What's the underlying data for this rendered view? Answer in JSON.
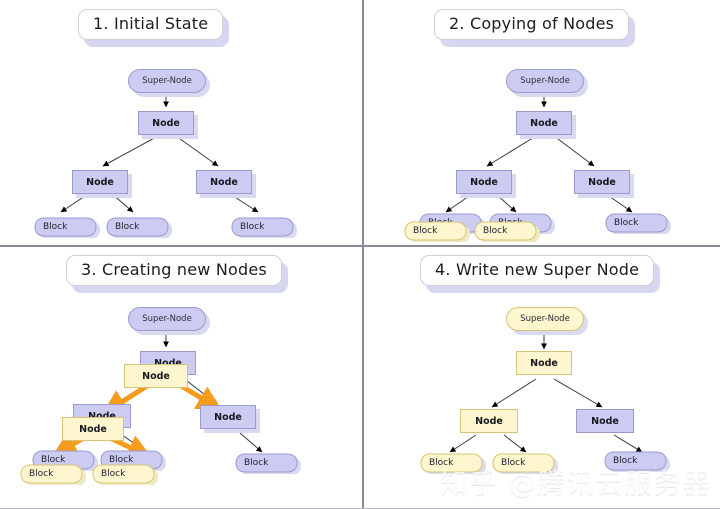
{
  "diagram": {
    "title_font_color": "#1c1c1c",
    "colors": {
      "purple_fill": "#ccccf2",
      "purple_stroke": "#9a9ad0",
      "yellow_fill": "#fdf6cf",
      "yellow_stroke": "#d8c476",
      "shadow": "#d9d9ef",
      "arrow_black": "#000000",
      "arrow_orange": "#f59c1a",
      "divider": "#8a8a96",
      "panel_bg": "#ffffff"
    }
  },
  "panels": [
    {
      "id": "panel-1",
      "title": "1. Initial State",
      "nodes": [
        {
          "name": "super-node",
          "label": "Super-Node",
          "shape": "supernode",
          "color": "purple"
        },
        {
          "name": "root-node",
          "label": "Node",
          "shape": "node",
          "color": "purple"
        },
        {
          "name": "left-node",
          "label": "Node",
          "shape": "node",
          "color": "purple"
        },
        {
          "name": "right-node",
          "label": "Node",
          "shape": "node",
          "color": "purple"
        },
        {
          "name": "block-1",
          "label": "Block",
          "shape": "block",
          "color": "purple"
        },
        {
          "name": "block-2",
          "label": "Block",
          "shape": "block",
          "color": "purple"
        },
        {
          "name": "block-3",
          "label": "Block",
          "shape": "block",
          "color": "purple"
        }
      ]
    },
    {
      "id": "panel-2",
      "title": "2. Copying of Nodes",
      "nodes": [
        {
          "name": "super-node",
          "label": "Super-Node",
          "shape": "supernode",
          "color": "purple"
        },
        {
          "name": "root-node",
          "label": "Node",
          "shape": "node",
          "color": "purple"
        },
        {
          "name": "left-node",
          "label": "Node",
          "shape": "node",
          "color": "purple"
        },
        {
          "name": "right-node",
          "label": "Node",
          "shape": "node",
          "color": "purple"
        },
        {
          "name": "block-1",
          "label": "Block",
          "shape": "block",
          "color": "purple"
        },
        {
          "name": "block-2",
          "label": "Block",
          "shape": "block",
          "color": "purple"
        },
        {
          "name": "block-3",
          "label": "Block",
          "shape": "block",
          "color": "purple"
        },
        {
          "name": "block-1-copy",
          "label": "Block",
          "shape": "block",
          "color": "yellow"
        },
        {
          "name": "block-2-copy",
          "label": "Block",
          "shape": "block",
          "color": "yellow"
        }
      ]
    },
    {
      "id": "panel-3",
      "title": "3. Creating new Nodes",
      "nodes": [
        {
          "name": "super-node",
          "label": "Super-Node",
          "shape": "supernode",
          "color": "purple"
        },
        {
          "name": "root-node",
          "label": "Node",
          "shape": "node",
          "color": "purple"
        },
        {
          "name": "root-node-copy",
          "label": "Node",
          "shape": "node",
          "color": "yellow"
        },
        {
          "name": "left-node",
          "label": "Node",
          "shape": "node",
          "color": "purple"
        },
        {
          "name": "left-node-copy",
          "label": "Node",
          "shape": "node",
          "color": "yellow"
        },
        {
          "name": "right-node",
          "label": "Node",
          "shape": "node",
          "color": "purple"
        },
        {
          "name": "block-1",
          "label": "Block",
          "shape": "block",
          "color": "purple"
        },
        {
          "name": "block-2",
          "label": "Block",
          "shape": "block",
          "color": "purple"
        },
        {
          "name": "block-3",
          "label": "Block",
          "shape": "block",
          "color": "purple"
        },
        {
          "name": "block-1-copy",
          "label": "Block",
          "shape": "block",
          "color": "yellow"
        },
        {
          "name": "block-2-copy",
          "label": "Block",
          "shape": "block",
          "color": "yellow"
        }
      ]
    },
    {
      "id": "panel-4",
      "title": "4. Write new Super Node",
      "nodes": [
        {
          "name": "super-node",
          "label": "Super-Node",
          "shape": "supernode",
          "color": "yellow"
        },
        {
          "name": "root-node",
          "label": "Node",
          "shape": "node",
          "color": "yellow"
        },
        {
          "name": "left-node",
          "label": "Node",
          "shape": "node",
          "color": "yellow"
        },
        {
          "name": "right-node",
          "label": "Node",
          "shape": "node",
          "color": "purple"
        },
        {
          "name": "block-1",
          "label": "Block",
          "shape": "block",
          "color": "yellow"
        },
        {
          "name": "block-2",
          "label": "Block",
          "shape": "block",
          "color": "yellow"
        },
        {
          "name": "block-3",
          "label": "Block",
          "shape": "block",
          "color": "purple"
        }
      ]
    }
  ],
  "watermark": {
    "text": "知乎 @腾讯云服务器"
  }
}
